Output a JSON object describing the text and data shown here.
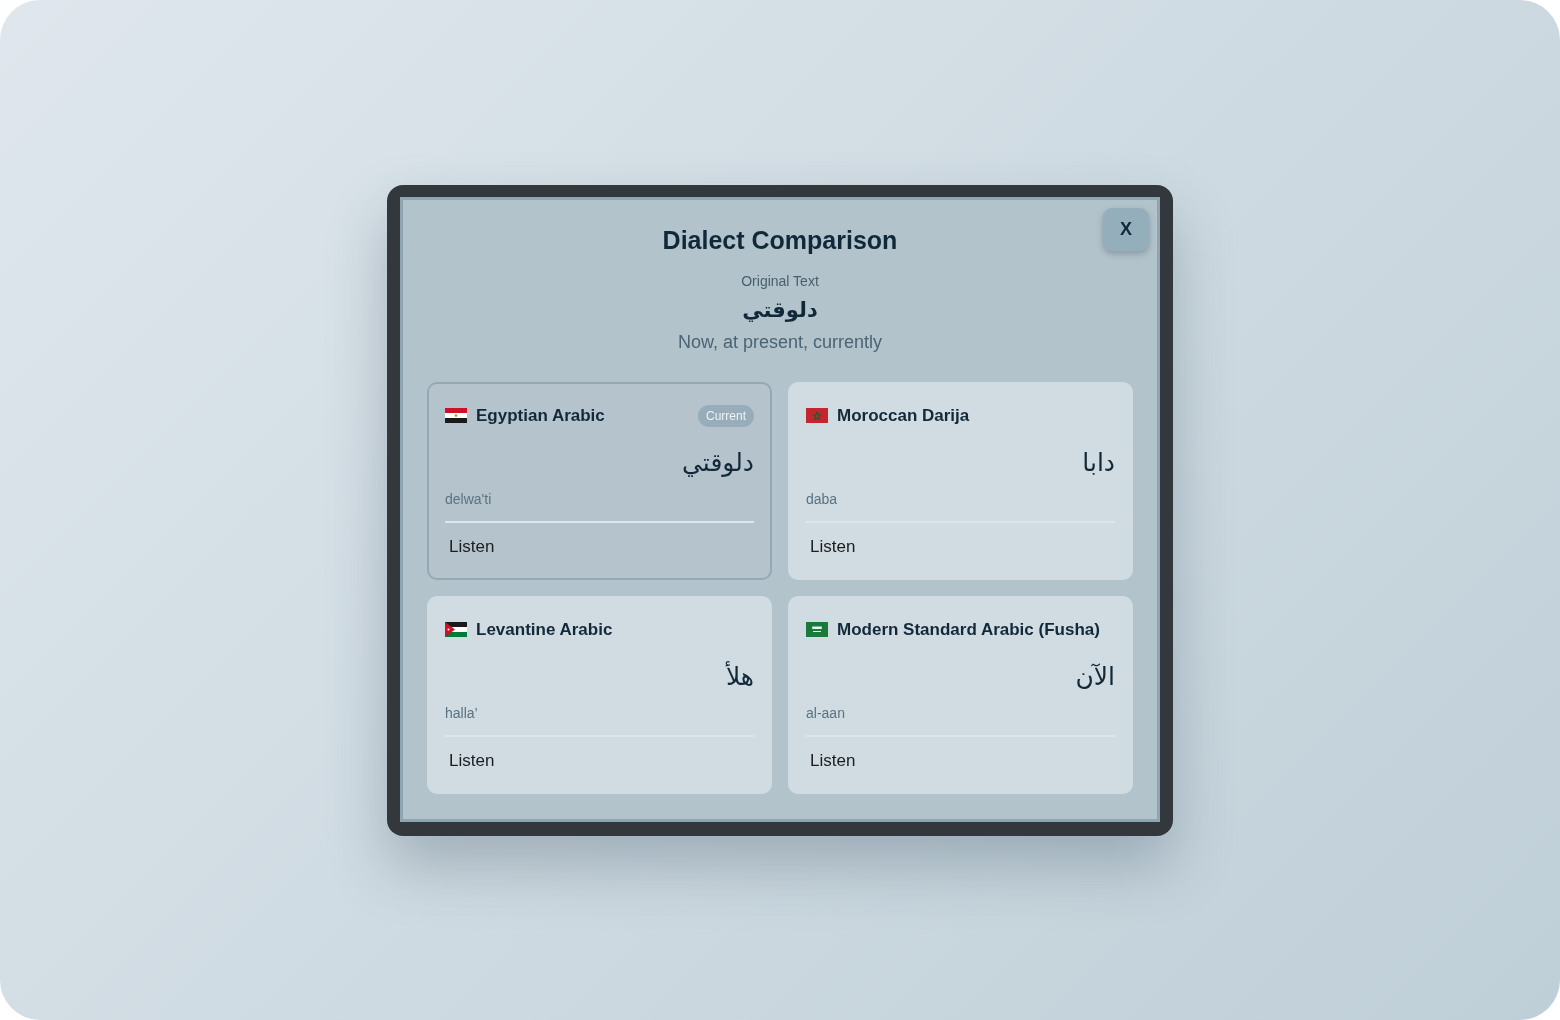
{
  "modal": {
    "title": "Dialect Comparison",
    "close_label": "X",
    "original": {
      "label": "Original Text",
      "text": "دلوقتي",
      "meaning": "Now, at present, currently"
    }
  },
  "dialects": [
    {
      "name": "Egyptian Arabic",
      "badge": "Current",
      "selected": true,
      "word": "دلوقتي",
      "romanization": "delwa'ti",
      "action": "Listen"
    },
    {
      "name": "Moroccan Darija",
      "selected": false,
      "word": "دابا",
      "romanization": "daba",
      "action": "Listen"
    },
    {
      "name": "Levantine Arabic",
      "selected": false,
      "word": "هلأ",
      "romanization": "halla’",
      "action": "Listen"
    },
    {
      "name": "Modern Standard Arabic (Fusha)",
      "selected": false,
      "word": "الآن",
      "romanization": "al-aan",
      "action": "Listen"
    }
  ]
}
